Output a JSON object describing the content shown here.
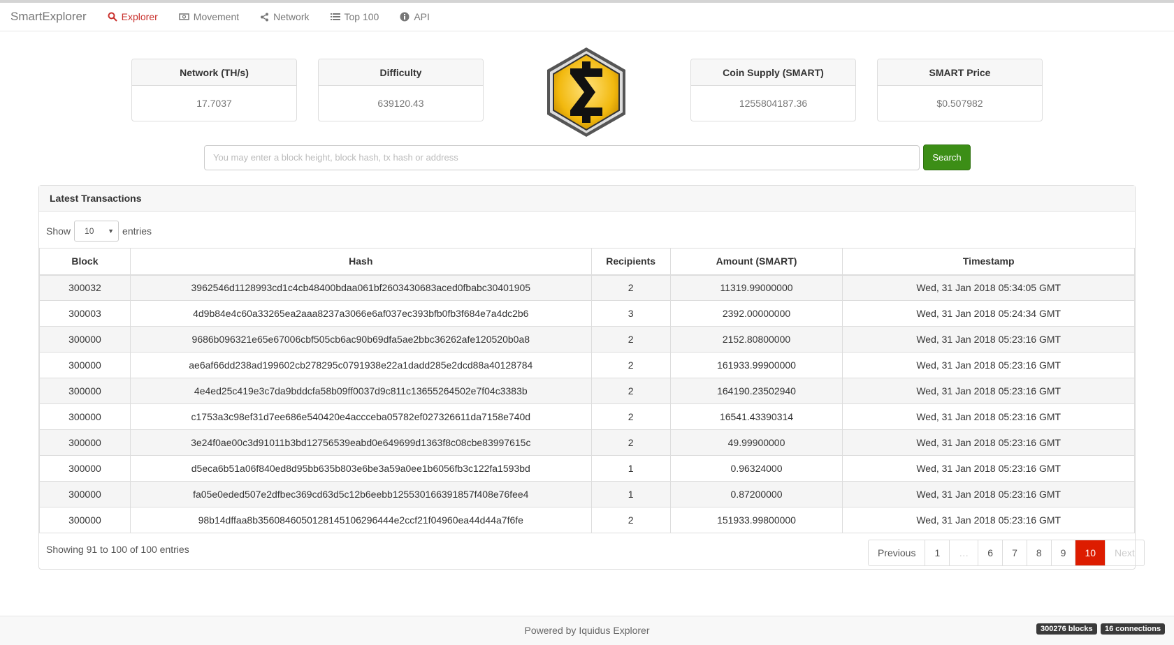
{
  "nav": {
    "brand": "SmartExplorer",
    "items": [
      {
        "label": "Explorer",
        "icon": "search-icon"
      },
      {
        "label": "Movement",
        "icon": "money-icon"
      },
      {
        "label": "Network",
        "icon": "share-icon"
      },
      {
        "label": "Top 100",
        "icon": "list-icon"
      },
      {
        "label": "API",
        "icon": "info-icon"
      }
    ]
  },
  "stats": {
    "network": {
      "label": "Network (TH/s)",
      "value": "17.7037"
    },
    "difficulty": {
      "label": "Difficulty",
      "value": "639120.43"
    },
    "supply": {
      "label": "Coin Supply (SMART)",
      "value": "1255804187.36"
    },
    "price": {
      "label": "SMART Price",
      "value": "$0.507982"
    }
  },
  "search": {
    "placeholder": "You may enter a block height, block hash, tx hash or address",
    "button": "Search"
  },
  "panel": {
    "title": "Latest Transactions",
    "show_label": "Show",
    "entries_label": "entries",
    "page_size": "10"
  },
  "table": {
    "columns": [
      "Block",
      "Hash",
      "Recipients",
      "Amount (SMART)",
      "Timestamp"
    ],
    "rows": [
      [
        "300032",
        "3962546d1128993cd1c4cb48400bdaa061bf2603430683aced0fbabc30401905",
        "2",
        "11319.99000000",
        "Wed, 31 Jan 2018 05:34:05 GMT"
      ],
      [
        "300003",
        "4d9b84e4c60a33265ea2aaa8237a3066e6af037ec393bfb0fb3f684e7a4dc2b6",
        "3",
        "2392.00000000",
        "Wed, 31 Jan 2018 05:24:34 GMT"
      ],
      [
        "300000",
        "9686b096321e65e67006cbf505cb6ac90b69dfa5ae2bbc36262afe120520b0a8",
        "2",
        "2152.80800000",
        "Wed, 31 Jan 2018 05:23:16 GMT"
      ],
      [
        "300000",
        "ae6af66dd238ad199602cb278295c0791938e22a1dadd285e2dcd88a40128784",
        "2",
        "161933.99900000",
        "Wed, 31 Jan 2018 05:23:16 GMT"
      ],
      [
        "300000",
        "4e4ed25c419e3c7da9bddcfa58b09ff0037d9c811c13655264502e7f04c3383b",
        "2",
        "164190.23502940",
        "Wed, 31 Jan 2018 05:23:16 GMT"
      ],
      [
        "300000",
        "c1753a3c98ef31d7ee686e540420e4accceba05782ef027326611da7158e740d",
        "2",
        "16541.43390314",
        "Wed, 31 Jan 2018 05:23:16 GMT"
      ],
      [
        "300000",
        "3e24f0ae00c3d91011b3bd12756539eabd0e649699d1363f8c08cbe83997615c",
        "2",
        "49.99900000",
        "Wed, 31 Jan 2018 05:23:16 GMT"
      ],
      [
        "300000",
        "d5eca6b51a06f840ed8d95bb635b803e6be3a59a0ee1b6056fb3c122fa1593bd",
        "1",
        "0.96324000",
        "Wed, 31 Jan 2018 05:23:16 GMT"
      ],
      [
        "300000",
        "fa05e0eded507e2dfbec369cd63d5c12b6eebb125530166391857f408e76fee4",
        "1",
        "0.87200000",
        "Wed, 31 Jan 2018 05:23:16 GMT"
      ],
      [
        "300000",
        "98b14dffaa8b3560846050128145106296444e2ccf21f04960ea44d44a7f6fe",
        "2",
        "151933.99800000",
        "Wed, 31 Jan 2018 05:23:16 GMT"
      ]
    ]
  },
  "footer_info": "Showing 91 to 100 of 100 entries",
  "pagination": {
    "previous": "Previous",
    "pages": [
      "1",
      "…",
      "6",
      "7",
      "8",
      "9",
      "10"
    ],
    "current": "10",
    "next": "Next"
  },
  "footer": {
    "text": "Powered by Iquidus Explorer",
    "blocks_badge": "300276 blocks",
    "connections_badge": "16 connections"
  },
  "colors": {
    "accent": "#c9302c",
    "search_button": "#3c8e16",
    "current_page": "#dd1c00",
    "logo_gold": "#f2b90f"
  }
}
